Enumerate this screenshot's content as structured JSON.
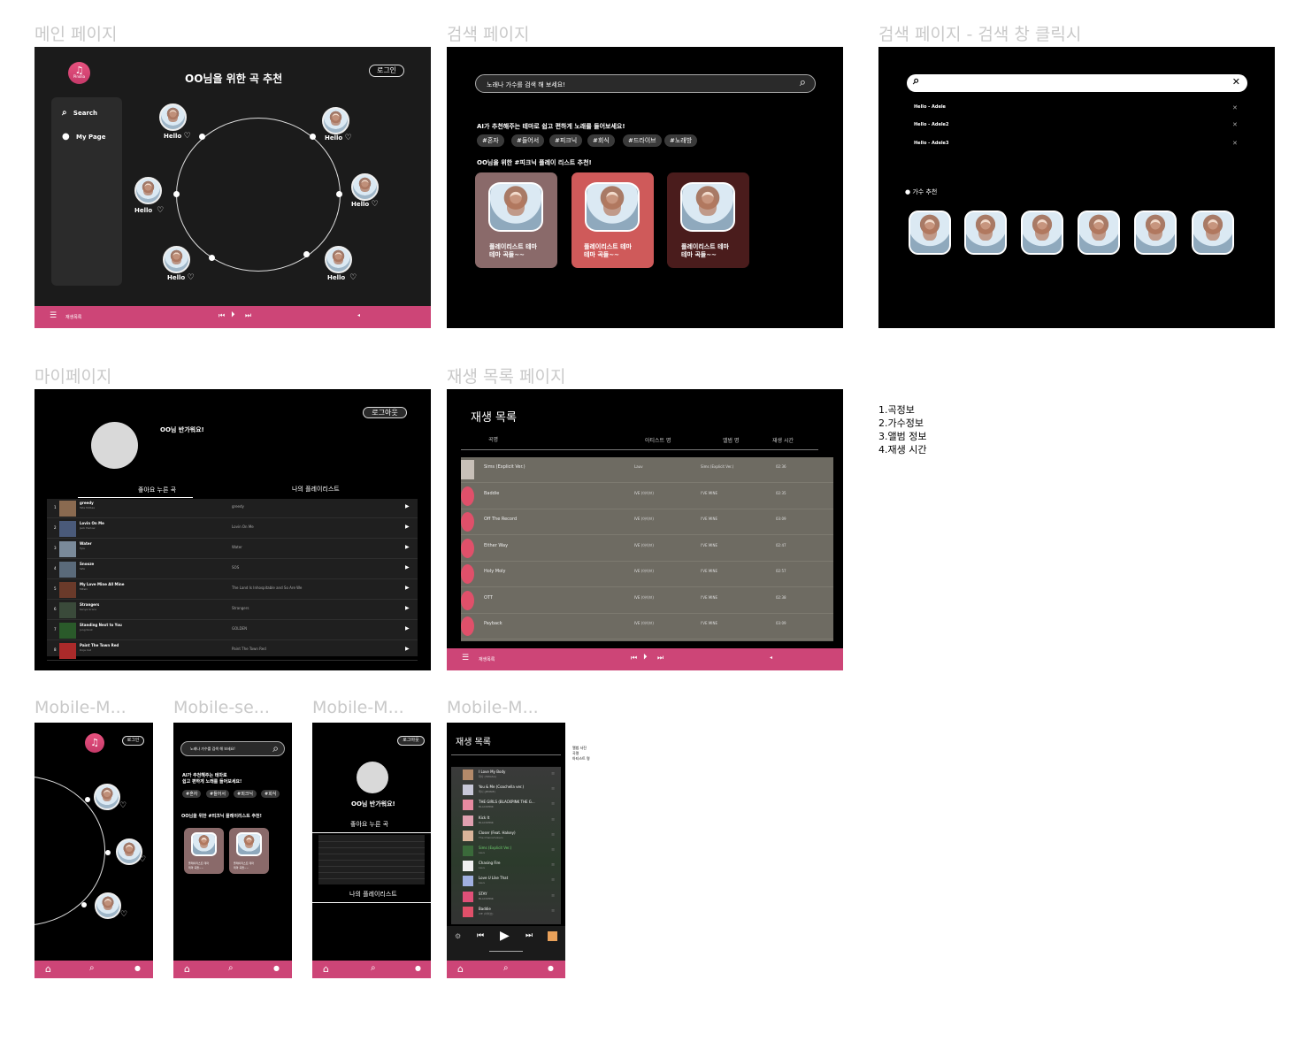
{
  "frames": {
    "main": "메인 페이지",
    "search": "검색 페이지",
    "search_click": "검색 페이지 - 검색 창 클릭시",
    "mypage": "마이페이지",
    "playlist": "재생 목록 페이지",
    "m1": "Mobile-M...",
    "m2": "Mobile-se...",
    "m3": "Mobile-M...",
    "m4": "Mobile-M..."
  },
  "main": {
    "logo": "Pinolia",
    "title": "OO님을 위한 곡 추천",
    "login": "로그인",
    "nav_search": "Search",
    "nav_mypage": "My Page",
    "song": "Hello",
    "playlist_label": "재생목록"
  },
  "search": {
    "placeholder": "노래나 가수를 검색 해 보세요!",
    "ai_title": "AI가 추천해주는 테마로 쉽고 편하게 노래를 들어보세요!",
    "tags": [
      "#혼자",
      "#들어서",
      "#피크닉",
      "#회식",
      "#드라이브",
      "#노래방"
    ],
    "pl_title": "OO님을 위한 #피크닉 플레이 리스트 추천!",
    "card1": "플레이리스트 테마",
    "card2": "테마 곡들~~"
  },
  "search_click": {
    "results": [
      "Hello - Adele",
      "Hello - Adele2",
      "Hello - Adele3"
    ],
    "artist_rec": "가수 추천"
  },
  "mypage": {
    "logout": "로그아웃",
    "greeting": "OO님 반가워요!",
    "tab_liked": "좋아요 누른 곡",
    "tab_playlist": "나의 플레이리스트",
    "rows": [
      {
        "n": "1",
        "t": "greedy",
        "a": "Tate McRae",
        "al": "greedy"
      },
      {
        "n": "2",
        "t": "Lovin On Me",
        "a": "Jack Harlow",
        "al": "Lovin On Me"
      },
      {
        "n": "3",
        "t": "Water",
        "a": "Tyla",
        "al": "Water"
      },
      {
        "n": "4",
        "t": "Snooze",
        "a": "SZA",
        "al": "SOS"
      },
      {
        "n": "5",
        "t": "My Love Mine All Mine",
        "a": "Mitski",
        "al": "The Land Is Inhospitable and So Are We"
      },
      {
        "n": "6",
        "t": "Strangers",
        "a": "Kenya Grace",
        "al": "Strangers"
      },
      {
        "n": "7",
        "t": "Standing Next to You",
        "a": "Jung Kook",
        "al": "GOLDEN"
      },
      {
        "n": "8",
        "t": "Paint The Town Red",
        "a": "Doja Cat",
        "al": "Paint The Town Red"
      }
    ]
  },
  "playlist": {
    "title": "재생 목록",
    "h_song": "곡명",
    "h_artist": "아티스트 명",
    "h_album": "앨범 명",
    "h_time": "재생 시간",
    "rows": [
      {
        "t": "Sims (Explicit Ver.)",
        "a": "Lauv",
        "al": "Sims (Explicit Ver.)",
        "d": "02:36"
      },
      {
        "t": "Baddie",
        "a": "IVE (아이브)",
        "al": "I'VE MINE",
        "d": "02:35"
      },
      {
        "t": "Off The Record",
        "a": "IVE (아이브)",
        "al": "I'VE MINE",
        "d": "03:09"
      },
      {
        "t": "Either Way",
        "a": "IVE (아이브)",
        "al": "I'VE MINE",
        "d": "02:47"
      },
      {
        "t": "Holy Moly",
        "a": "IVE (아이브)",
        "al": "I'VE MINE",
        "d": "02:57"
      },
      {
        "t": "OTT",
        "a": "IVE (아이브)",
        "al": "I'VE MINE",
        "d": "02:38"
      },
      {
        "t": "Payback",
        "a": "IVE (아이브)",
        "al": "I'VE MINE",
        "d": "03:09"
      }
    ],
    "bar_label": "재생목록"
  },
  "notes": [
    "1.곡정보",
    "2.가수정보",
    "3.앨범 정보",
    "4.재생 시간"
  ],
  "mobile": {
    "login": "로그인",
    "logout": "로그아웃",
    "search_ph": "노래나 가수를 검색 해 보세요!",
    "ai_title1": "AI가 추천해주는 테마로",
    "ai_title2": "쉽고 편하게 노래를 들어보세요!",
    "tags": [
      "#혼자",
      "#들어서",
      "#피크닉",
      "#회식"
    ],
    "pl_title": "OO님을 위한 #피크닉 플레이리스트 추천!",
    "card1": "플레이리스트 테마",
    "card2": "테마 곡들~~",
    "greeting": "OO님 반가워요!",
    "liked": "좋아요 누른 곡",
    "my_pl": "나의 플레이리스트",
    "pl_title_m": "재생 목록",
    "note": [
      "앨범 사진",
      "곡명",
      "아티스트 명"
    ],
    "rows": [
      {
        "t": "I Love My Body",
        "a": "화사 (HWASA)"
      },
      {
        "t": "You & Me (Coachella ver.)",
        "a": "제니 (JENNIE)"
      },
      {
        "t": "THE GIRLS (BLACKPINK THE G...",
        "a": "BLACKPINK"
      },
      {
        "t": "Kick It",
        "a": "BLACKPINK"
      },
      {
        "t": "Closer (Feat. Halsey)",
        "a": "The Chainsmokers"
      },
      {
        "t": "Sims (Explicit Ver.)",
        "a": "Lauv"
      },
      {
        "t": "Chasing Fire",
        "a": "Lauv"
      },
      {
        "t": "Love U Like That",
        "a": "Lauv"
      },
      {
        "t": "STAY",
        "a": "BLACKPINK"
      },
      {
        "t": "Baddie",
        "a": "IVE (아이브)"
      }
    ]
  }
}
